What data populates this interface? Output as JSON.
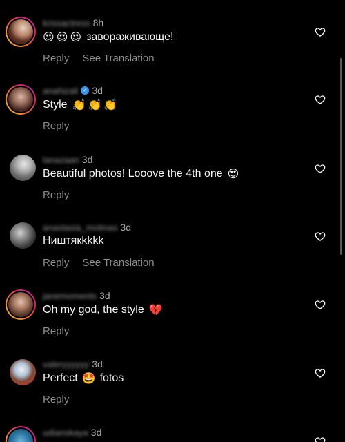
{
  "comments": [
    {
      "username": "krissactress",
      "time": "8h",
      "verified": false,
      "text": "заворaживающе!",
      "emojis": [
        "😍",
        "😍",
        "😍"
      ],
      "actions": [
        "Reply",
        "See Translation"
      ]
    },
    {
      "username": "anahizali",
      "time": "3d",
      "verified": true,
      "text": "Style",
      "emojis": [
        "👏",
        "👏",
        "👏"
      ],
      "actions": [
        "Reply"
      ]
    },
    {
      "username": "lanazaan",
      "time": "3d",
      "verified": false,
      "text": "Beautiful photos! Looove the 4th one",
      "emojis": [
        "😍"
      ],
      "actions": [
        "Reply"
      ]
    },
    {
      "username": "anastasia_motinas",
      "time": "3d",
      "verified": false,
      "text": "Ништякkkkk",
      "emojis": [],
      "actions": [
        "Reply",
        "See Translation"
      ]
    },
    {
      "username": "janemoments",
      "time": "3d",
      "verified": false,
      "text": "Oh my god, the style",
      "emojis": [
        "💔"
      ],
      "actions": [
        "Reply"
      ]
    },
    {
      "username": "valeryyyyyy",
      "time": "3d",
      "verified": false,
      "text_before": "Perfect",
      "emoji_mid": "🤩",
      "text_after": "fotos",
      "actions": [
        "Reply"
      ]
    },
    {
      "username": "udianskaya",
      "time": "3d",
      "verified": false
    }
  ],
  "icons": {
    "like": "heart-outline-icon",
    "verified": "verified-badge-icon"
  },
  "colors": {
    "background": "#000000",
    "primary_text": "#f5f5f5",
    "secondary_text": "#8e8e8e",
    "verified": "#3797f0"
  }
}
